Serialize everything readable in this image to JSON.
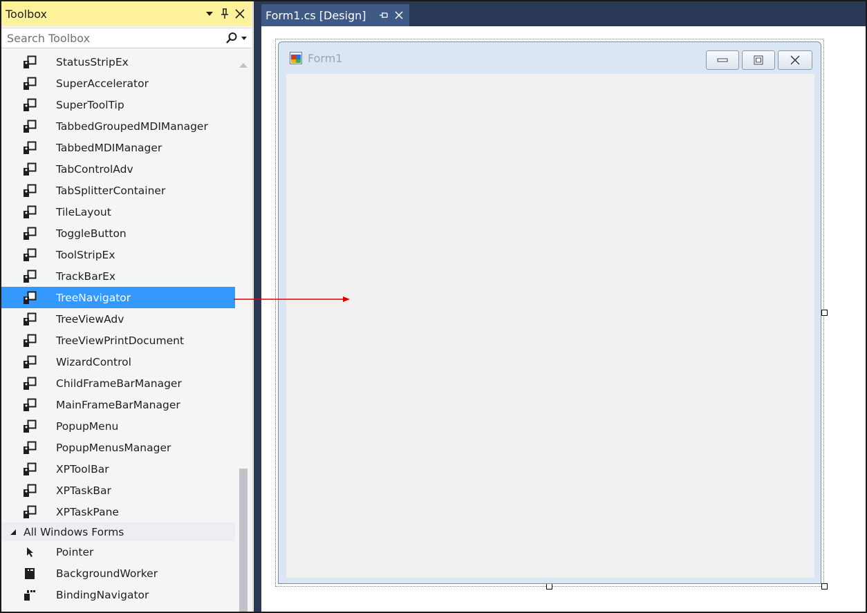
{
  "toolbox": {
    "title": "Toolbox",
    "search_placeholder": "Search Toolbox",
    "items": [
      {
        "label": "StatusStripEx"
      },
      {
        "label": "SuperAccelerator"
      },
      {
        "label": "SuperToolTip"
      },
      {
        "label": "TabbedGroupedMDIManager"
      },
      {
        "label": "TabbedMDIManager"
      },
      {
        "label": "TabControlAdv"
      },
      {
        "label": "TabSplitterContainer"
      },
      {
        "label": "TileLayout"
      },
      {
        "label": "ToggleButton"
      },
      {
        "label": "ToolStripEx"
      },
      {
        "label": "TrackBarEx"
      },
      {
        "label": "TreeNavigator",
        "selected": true
      },
      {
        "label": "TreeViewAdv"
      },
      {
        "label": "TreeViewPrintDocument"
      },
      {
        "label": "WizardControl"
      },
      {
        "label": "ChildFrameBarManager"
      },
      {
        "label": "MainFrameBarManager"
      },
      {
        "label": "PopupMenu"
      },
      {
        "label": "PopupMenusManager"
      },
      {
        "label": "XPToolBar"
      },
      {
        "label": "XPTaskBar"
      },
      {
        "label": "XPTaskPane"
      }
    ],
    "group": {
      "label": "All Windows Forms"
    },
    "group_items": [
      {
        "label": "Pointer",
        "icon": "pointer-icon"
      },
      {
        "label": "BackgroundWorker",
        "icon": "background-worker-icon"
      },
      {
        "label": "BindingNavigator",
        "icon": "binding-navigator-icon"
      }
    ],
    "title_bar_color": "#fff29d",
    "selection_color": "#3399ff"
  },
  "document": {
    "tab_label": "Form1.cs [Design]",
    "strip_color": "#293955"
  },
  "form": {
    "caption": "Form1"
  },
  "annotation": {
    "arrow_color": "#e00000"
  }
}
